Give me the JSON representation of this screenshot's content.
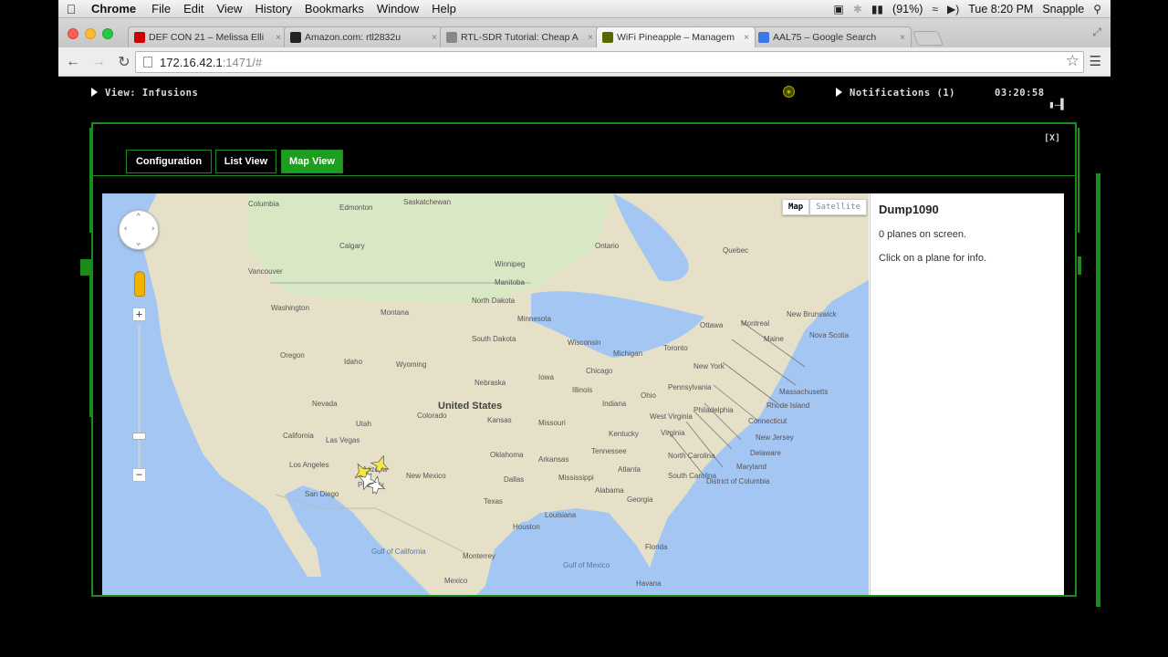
{
  "menubar": {
    "app": "Chrome",
    "items": [
      "File",
      "Edit",
      "View",
      "History",
      "Bookmarks",
      "Window",
      "Help"
    ],
    "battery": "(91%)",
    "clock": "Tue 8:20 PM",
    "user": "Snapple"
  },
  "tabs": [
    {
      "title": "DEF CON 21 – Melissa Elli",
      "icon": "youtube-icon",
      "color": "#cc0000"
    },
    {
      "title": "Amazon.com: rtl2832u",
      "icon": "amazon-icon",
      "color": "#222222"
    },
    {
      "title": "RTL-SDR Tutorial: Cheap A",
      "icon": "page-icon",
      "color": "#888888"
    },
    {
      "title": "WiFi Pineapple – Managem",
      "icon": "pineapple-icon",
      "color": "#556b00"
    },
    {
      "title": "AAL75 – Google Search",
      "icon": "google-icon",
      "color": "#3b78e7"
    }
  ],
  "address": {
    "host": "172.16.42.1",
    "path": ":1471/#"
  },
  "page": {
    "view_label": "View: Infusions",
    "notifications_label": "Notifications (1)",
    "time": "03:20:58",
    "close_label": "[X]"
  },
  "panel_tabs": [
    {
      "label": "Configuration",
      "active": false
    },
    {
      "label": "List View",
      "active": false
    },
    {
      "label": "Map View",
      "active": true
    }
  ],
  "map": {
    "type_map": "Map",
    "type_satellite": "Satellite",
    "country_label": "United States",
    "labels": [
      "Edmonton",
      "Saskatchewan",
      "Calgary",
      "Vancouver",
      "Winnipeg",
      "Ontario",
      "Quebec",
      "Washington",
      "Montana",
      "North Dakota",
      "Minnesota",
      "Ottawa",
      "Montreal",
      "New Brunswick",
      "Oregon",
      "Idaho",
      "South Dakota",
      "Wisconsin",
      "Michigan",
      "Toronto",
      "Maine",
      "Nova Scotia",
      "Wyoming",
      "Nevada",
      "Nebraska",
      "Iowa",
      "Chicago",
      "New York",
      "Pennsylvania",
      "Massachusetts",
      "Colorado",
      "Illinois",
      "Indiana",
      "Ohio",
      "Rhode Island",
      "California",
      "Utah",
      "Kansas",
      "Missouri",
      "Kentucky",
      "West Virginia",
      "Philadelphia",
      "Connecticut",
      "Las Vegas",
      "Oklahoma",
      "Tennessee",
      "Virginia",
      "New Jersey",
      "Los Angeles",
      "Arizona",
      "Arkansas",
      "Atlanta",
      "North Carolina",
      "Delaware",
      "Maryland",
      "San Diego",
      "New Mexico",
      "Dallas",
      "Mississippi",
      "South Carolina",
      "District of Columbia",
      "Phoenix",
      "Texas",
      "Alabama",
      "Georgia",
      "Houston",
      "Louisiana",
      "Monterrey",
      "Gulf of California",
      "Gulf of Mexico",
      "Florida",
      "Mexico",
      "Havana",
      "Columbia",
      "Manitoba"
    ]
  },
  "info": {
    "title": "Dump1090",
    "planes_text": "0 planes on screen.",
    "hint_text": "Click on a plane for info."
  },
  "colors": {
    "accent": "#1e9e1e",
    "panel_border": "#1a8c1a"
  }
}
